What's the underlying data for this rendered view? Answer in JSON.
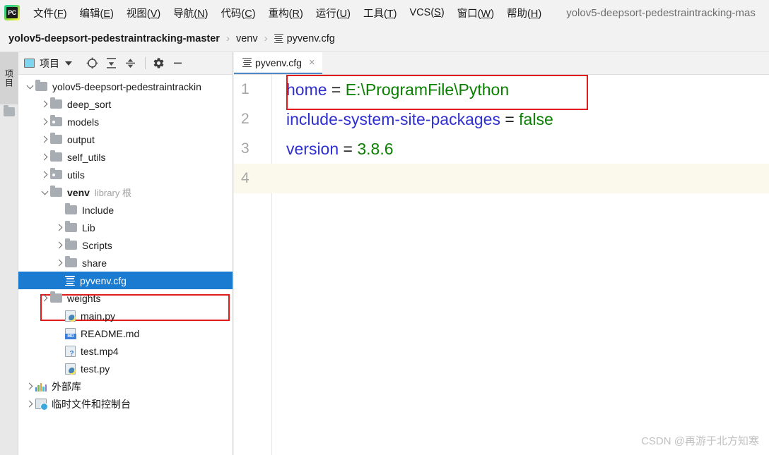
{
  "app": {
    "logo_text": "PC",
    "window_title": "yolov5-deepsort-pedestraintracking-mas"
  },
  "menubar": {
    "items": [
      {
        "label": "文件",
        "mnemonic": "F"
      },
      {
        "label": "编辑",
        "mnemonic": "E"
      },
      {
        "label": "视图",
        "mnemonic": "V"
      },
      {
        "label": "导航",
        "mnemonic": "N"
      },
      {
        "label": "代码",
        "mnemonic": "C"
      },
      {
        "label": "重构",
        "mnemonic": "R"
      },
      {
        "label": "运行",
        "mnemonic": "U"
      },
      {
        "label": "工具",
        "mnemonic": "T"
      },
      {
        "label": "VCS",
        "mnemonic": "S"
      },
      {
        "label": "窗口",
        "mnemonic": "W"
      },
      {
        "label": "帮助",
        "mnemonic": "H"
      }
    ]
  },
  "breadcrumb": {
    "root": "yolov5-deepsort-pedestraintracking-master",
    "folder": "venv",
    "file": "pyvenv.cfg",
    "separator": "›"
  },
  "left_stripe": {
    "tool_label": "项目"
  },
  "project_panel": {
    "title": "项目",
    "toolbar_icons": [
      "locate-icon",
      "collapse-all-icon",
      "expand-icon",
      "gear-icon",
      "minimize-icon"
    ],
    "tree": [
      {
        "label": "yolov5-deepsort-pedestraintrackin",
        "type": "folder",
        "indent": 0,
        "state": "expanded",
        "bold": false
      },
      {
        "label": "deep_sort",
        "type": "folder",
        "indent": 1,
        "state": "collapsed",
        "bold": false
      },
      {
        "label": "models",
        "type": "folder-source",
        "indent": 1,
        "state": "collapsed",
        "bold": false
      },
      {
        "label": "output",
        "type": "folder",
        "indent": 1,
        "state": "collapsed",
        "bold": false
      },
      {
        "label": "self_utils",
        "type": "folder",
        "indent": 1,
        "state": "collapsed",
        "bold": false
      },
      {
        "label": "utils",
        "type": "folder-source",
        "indent": 1,
        "state": "collapsed",
        "bold": false
      },
      {
        "label": "venv",
        "sublabel": "library 根",
        "type": "folder",
        "indent": 1,
        "state": "expanded",
        "bold": true
      },
      {
        "label": "Include",
        "type": "folder",
        "indent": 2,
        "state": "leaf",
        "bold": false
      },
      {
        "label": "Lib",
        "type": "folder",
        "indent": 2,
        "state": "collapsed",
        "bold": false
      },
      {
        "label": "Scripts",
        "type": "folder",
        "indent": 2,
        "state": "collapsed",
        "bold": false
      },
      {
        "label": "share",
        "type": "folder",
        "indent": 2,
        "state": "collapsed",
        "bold": false
      },
      {
        "label": "pyvenv.cfg",
        "type": "cfg",
        "indent": 2,
        "state": "leaf",
        "bold": false,
        "selected": true
      },
      {
        "label": "weights",
        "type": "folder",
        "indent": 1,
        "state": "collapsed",
        "bold": false
      },
      {
        "label": "main.py",
        "type": "python",
        "indent": 2,
        "state": "leaf",
        "bold": false
      },
      {
        "label": "README.md",
        "type": "markdown",
        "indent": 2,
        "state": "leaf",
        "bold": false
      },
      {
        "label": "test.mp4",
        "type": "video",
        "indent": 2,
        "state": "leaf",
        "bold": false
      },
      {
        "label": "test.py",
        "type": "python",
        "indent": 2,
        "state": "leaf",
        "bold": false
      },
      {
        "label": "外部库",
        "type": "external-libraries",
        "indent": 0,
        "state": "collapsed",
        "bold": false
      },
      {
        "label": "临时文件和控制台",
        "type": "scratches",
        "indent": 0,
        "state": "collapsed",
        "bold": false
      }
    ]
  },
  "editor": {
    "tab": {
      "label": "pyvenv.cfg",
      "close": "×",
      "icon": "config-file-icon"
    },
    "lines": [
      {
        "number": "1",
        "key": "home",
        "eq": "=",
        "value": "E:\\ProgramFile\\Python",
        "active": false
      },
      {
        "number": "2",
        "key": "include-system-site-packages",
        "eq": "=",
        "value": "false",
        "active": false
      },
      {
        "number": "3",
        "key": "version",
        "eq": "=",
        "value": "3.8.6",
        "active": false
      },
      {
        "number": "4",
        "key": "",
        "eq": "",
        "value": "",
        "active": true
      }
    ]
  },
  "annotations": {
    "editor_highlight": "home = E:\\ProgramFile\\Python",
    "tree_highlight": "pyvenv.cfg",
    "color": "#e01b1b"
  },
  "watermark": {
    "text": "CSDN @再游于北方知寒"
  },
  "colors": {
    "accent": "#1a7bd0",
    "key": "#2f2fd0",
    "value": "#0a8000",
    "annotation": "#e01b1b",
    "current_line": "#fbf9ec"
  }
}
